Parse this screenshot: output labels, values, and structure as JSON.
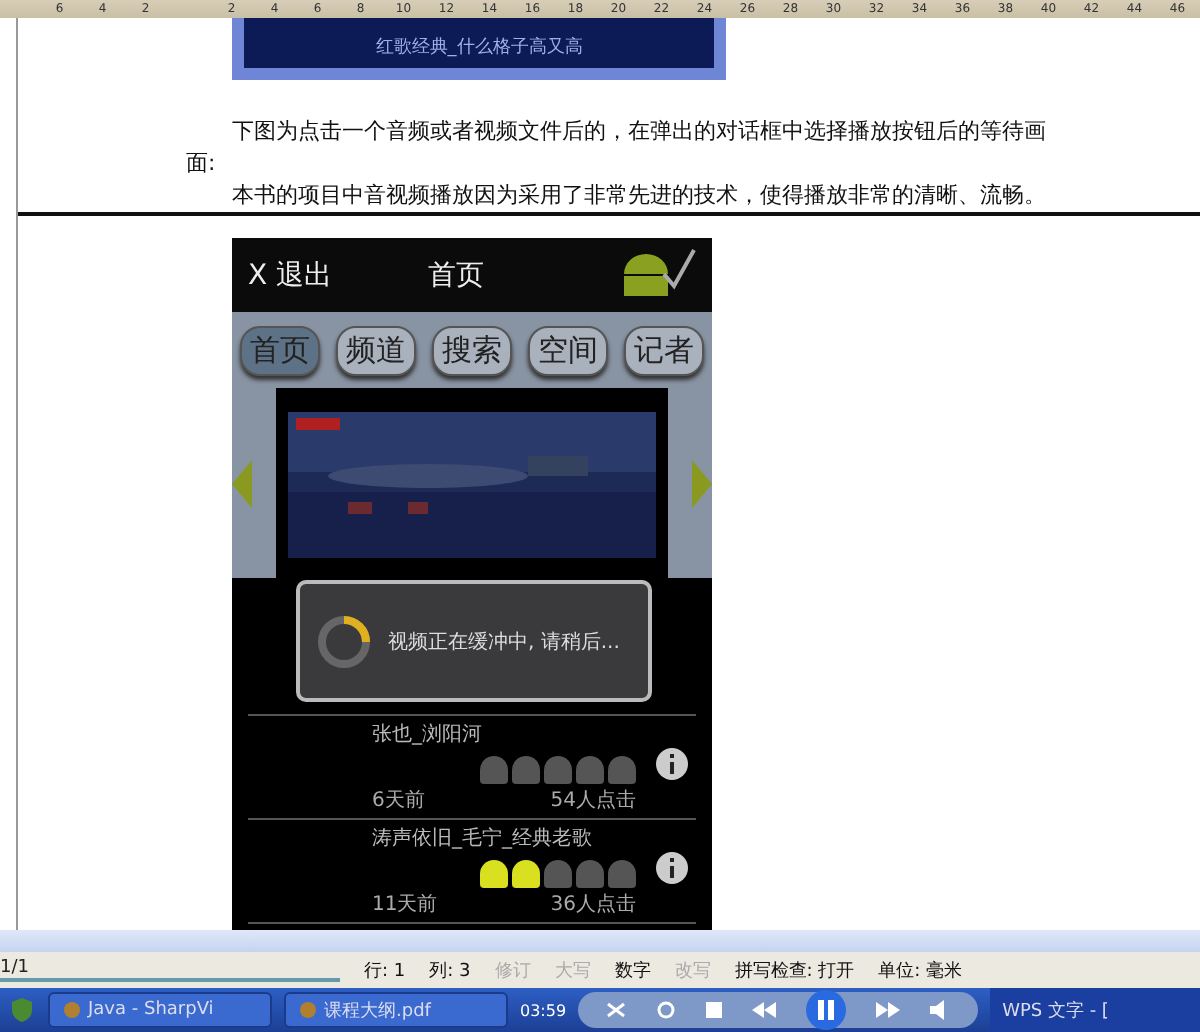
{
  "ruler": {
    "ticks": [
      "6",
      "4",
      "2",
      "2",
      "4",
      "6",
      "8",
      "10",
      "12",
      "14",
      "16",
      "18",
      "20",
      "22",
      "24",
      "26",
      "28",
      "30",
      "32",
      "34",
      "36",
      "38",
      "40",
      "42",
      "44",
      "46"
    ]
  },
  "document": {
    "image_caption": "红歌经典_什么格子高又高",
    "paragraphs": [
      "下图为点击一个音频或者视频文件后的，在弹出的对话框中选择播放按钮后的等待画面:",
      "本书的项目中音视频播放因为采用了非常先进的技术，使得播放非常的清晰、流畅。"
    ]
  },
  "phone": {
    "exit": "X 退出",
    "title": "首页",
    "tabs": [
      {
        "label": "首页",
        "selected": true
      },
      {
        "label": "频道",
        "selected": false
      },
      {
        "label": "搜索",
        "selected": false
      },
      {
        "label": "空间",
        "selected": false
      },
      {
        "label": "记者",
        "selected": false
      }
    ],
    "dialog": {
      "message": "视频正在缓冲中, 请稍后..."
    },
    "list": [
      {
        "title": "张也_浏阳河",
        "stars": 0,
        "age": "6天前",
        "clicks": "54人点击"
      },
      {
        "title": "涛声依旧_毛宁_经典老歌",
        "stars": 2,
        "age": "11天前",
        "clicks": "36人点击"
      }
    ]
  },
  "status_bar": {
    "page": "1/1",
    "items": [
      {
        "text": "行: 1",
        "enabled": true
      },
      {
        "text": "列: 3",
        "enabled": true
      },
      {
        "text": "修订",
        "enabled": false
      },
      {
        "text": "大写",
        "enabled": false
      },
      {
        "text": "数字",
        "enabled": true
      },
      {
        "text": "改写",
        "enabled": false
      },
      {
        "text": "拼写检查: 打开",
        "enabled": true
      },
      {
        "text": "单位: 毫米",
        "enabled": true
      }
    ]
  },
  "taskbar": {
    "items": [
      {
        "label": "Java - SharpVi"
      },
      {
        "label": "课程大纲.pdf"
      }
    ],
    "time": "03:59",
    "tray_label": "WPS 文字 - ["
  }
}
